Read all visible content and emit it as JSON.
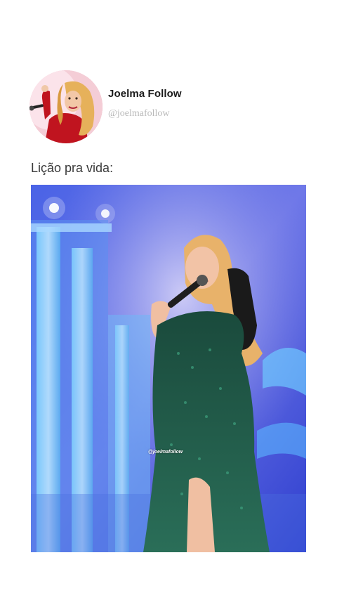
{
  "post": {
    "author": {
      "display_name": "Joelma Follow",
      "handle": "@joelmafollow",
      "avatar_icon": "profile-photo-singer-red-outfit"
    },
    "caption": "Lição pra vida:",
    "media": {
      "type": "photo",
      "subject": "singer-performing-green-sequin-dress",
      "watermark": "@joelmafollow"
    }
  },
  "colors": {
    "background": "#ffffff",
    "name_text": "#1b1b1b",
    "handle_text": "#b9b9b9",
    "caption_text": "#3a3a3a",
    "stage_blue": "#3a54d8",
    "dress_green": "#1f5c4a"
  }
}
